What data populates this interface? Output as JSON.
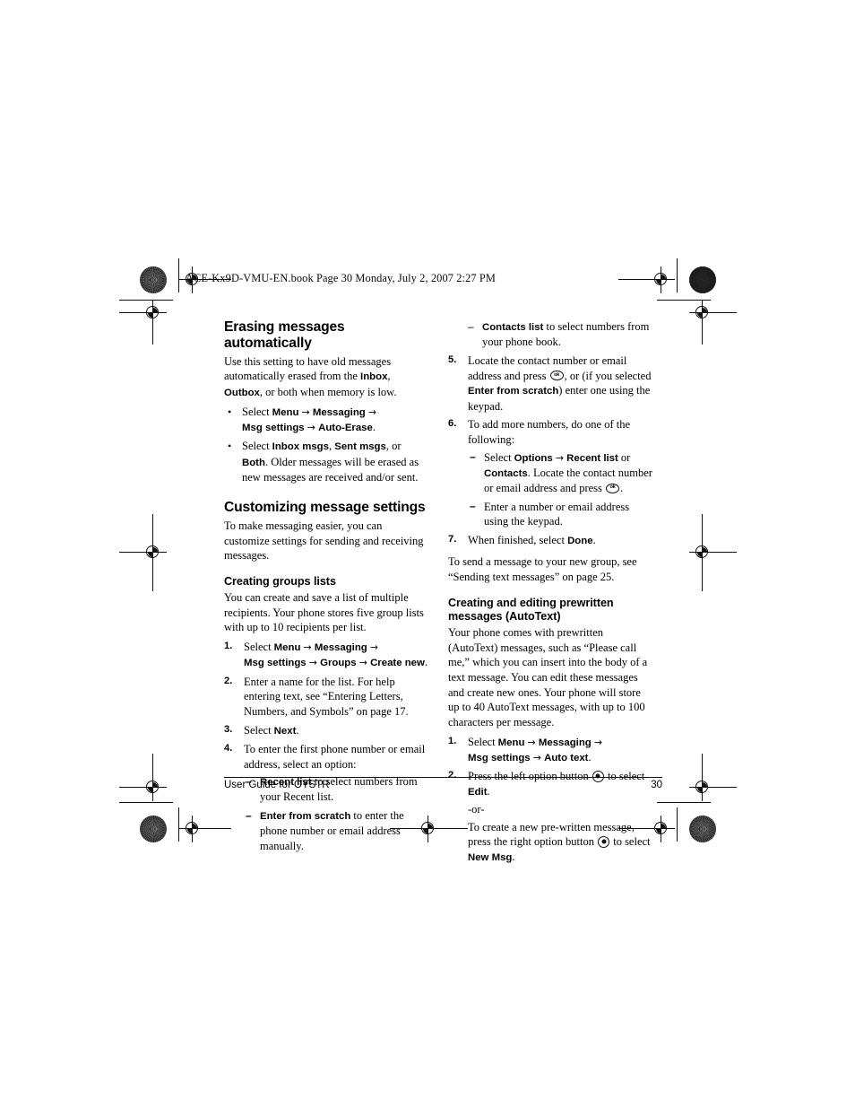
{
  "header": {
    "file_stamp": "ACE-Kx9D-VMU-EN.book  Page 30  Monday, July 2, 2007  2:27 PM"
  },
  "footer": {
    "guide_title": "User Guide for OYSTR",
    "page_number": "30"
  },
  "left_column": {
    "erasing": {
      "heading": "Erasing messages automatically",
      "intro_1": "Use this setting to have old messages automatically erased from the ",
      "intro_inbox": "Inbox",
      "intro_2": ", ",
      "intro_outbox": "Outbox",
      "intro_3": ", or both when memory is low.",
      "bullet_1": {
        "select": "Select ",
        "menu": "Menu",
        "arrow_1": "→",
        "messaging": "Messaging",
        "arrow_2": "→",
        "msg_settings": "Msg settings",
        "arrow_3": "→",
        "auto_erase": "Auto-Erase",
        "period": "."
      },
      "bullet_2": {
        "select": "Select ",
        "inbox_msgs": "Inbox msgs",
        "sep_1": ", ",
        "sent_msgs": "Sent msgs",
        "sep_2": ", or ",
        "both": "Both",
        "tail": ". Older messages will be erased as new messages are received and/or sent."
      }
    },
    "customizing": {
      "heading": "Customizing message settings",
      "intro": "To make messaging easier, you can customize settings for sending and receiving messages."
    },
    "groups": {
      "heading": "Creating groups lists",
      "intro": "You can create and save a list of multiple recipients. Your phone stores five group lists with up to 10 recipients per list.",
      "step_1": {
        "num": "1.",
        "select": "Select ",
        "menu": "Menu",
        "arrow_1": "→",
        "messaging": "Messaging",
        "arrow_2": "→",
        "msg_settings": "Msg settings",
        "arrow_3": "→",
        "groups": "Groups",
        "arrow_4": "→",
        "create_new": "Create new",
        "period": "."
      },
      "step_2": {
        "num": "2.",
        "text": "Enter a name for the list. For help entering text, see “Entering Letters, Numbers, and Symbols” on page 17."
      },
      "step_3": {
        "num": "3.",
        "select": "Select ",
        "next": "Next",
        "period": "."
      },
      "step_4": {
        "num": "4.",
        "text": "To enter the first phone number or email address, select an option:",
        "dash_1": {
          "bold": "Recent list",
          "text": " to select numbers from your Recent list."
        },
        "dash_2": {
          "bold": "Enter from scratch",
          "text": " to enter the phone number or email address manually."
        }
      }
    }
  },
  "right_column": {
    "groups_cont": {
      "dash_contacts": {
        "bold": "Contacts list",
        "text": " to select numbers from your phone book."
      },
      "step_5": {
        "num": "5.",
        "text_1": "Locate the contact number or email address and press ",
        "text_2": ", or (if you selected ",
        "bold": "Enter from scratch",
        "text_3": ") enter one using the keypad."
      },
      "step_6": {
        "num": "6.",
        "text": "To add more numbers, do one of the following:",
        "dash_1": {
          "select": "Select ",
          "options": "Options",
          "arrow": "→",
          "recent_list": "Recent list",
          "or": " or ",
          "contacts": "Contacts",
          "tail": ". Locate the contact number or email address and press ",
          "period": "."
        },
        "dash_2": {
          "text": "Enter a number or email address using the keypad."
        }
      },
      "step_7": {
        "num": "7.",
        "text_1": "When finished, select ",
        "done": "Done",
        "period": "."
      },
      "closing": "To send a message to your new group, see “Sending text messages” on page 25."
    },
    "autotext": {
      "heading_line_1": "Creating and editing prewritten",
      "heading_line_2": "messages (AutoText)",
      "intro": "Your phone comes with prewritten (AutoText) messages, such as “Please call me,” which you can insert into the body of a text message. You can edit these messages and create new ones. Your phone will store up to 40 AutoText messages, with up to 100 characters per message.",
      "step_1": {
        "num": "1.",
        "select": "Select ",
        "menu": "Menu",
        "arrow_1": "→",
        "messaging": "Messaging",
        "arrow_2": "→",
        "msg_settings": "Msg settings",
        "arrow_3": "→",
        "auto_text": "Auto text",
        "period": "."
      },
      "step_2": {
        "num": "2.",
        "text_1": "Press the left option button ",
        "text_2": " to select ",
        "edit": "Edit",
        "period_1": ".",
        "or_label": "-or-",
        "text_3": "To create a new pre-written message, press the right option button ",
        "text_4": " to select ",
        "new_msg": "New Msg",
        "period_2": "."
      }
    }
  },
  "icons": {
    "ok_key": "ok-key-icon",
    "option_button": "option-button-icon",
    "registration_mark": "registration-target-icon",
    "halftone_mark": "halftone-density-icon"
  }
}
